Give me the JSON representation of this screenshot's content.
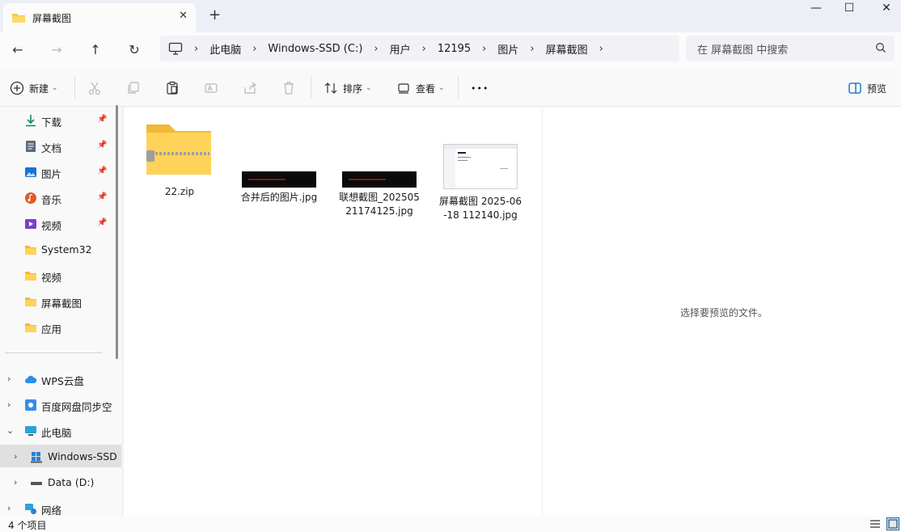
{
  "tab": {
    "title": "屏幕截图",
    "close": "✕",
    "new_tab": "+"
  },
  "window": {
    "minimize": "—",
    "maximize": "☐",
    "close": "✕"
  },
  "nav": {
    "back": "←",
    "forward": "→",
    "up": "↑",
    "refresh": "↻"
  },
  "breadcrumbs": [
    "此电脑",
    "Windows-SSD (C:)",
    "用户",
    "12195",
    "图片",
    "屏幕截图"
  ],
  "search": {
    "placeholder": "在 屏幕截图 中搜索"
  },
  "toolbar": {
    "new_label": "新建",
    "sort_label": "排序",
    "view_label": "查看",
    "more_label": "•••",
    "preview_label": "预览"
  },
  "sidebar": {
    "quick_access": [
      {
        "label": "下载",
        "icon": "download-icon",
        "pinned": true
      },
      {
        "label": "文档",
        "icon": "document-icon",
        "pinned": true
      },
      {
        "label": "图片",
        "icon": "pictures-icon",
        "pinned": true
      },
      {
        "label": "音乐",
        "icon": "music-icon",
        "pinned": true
      },
      {
        "label": "视频",
        "icon": "video-icon",
        "pinned": true
      },
      {
        "label": "System32",
        "icon": "folder-icon",
        "pinned": false
      },
      {
        "label": "视频",
        "icon": "folder-icon",
        "pinned": false
      },
      {
        "label": "屏幕截图",
        "icon": "folder-icon",
        "pinned": false
      },
      {
        "label": "应用",
        "icon": "folder-icon",
        "pinned": false
      }
    ],
    "tree": [
      {
        "label": "WPS云盘",
        "icon": "cloud-icon"
      },
      {
        "label": "百度网盘同步空",
        "icon": "baidu-netdisk-icon"
      },
      {
        "label": "此电脑",
        "icon": "pc-icon"
      },
      {
        "label": "Windows-SSD",
        "icon": "windows-drive-icon"
      },
      {
        "label": "Data (D:)",
        "icon": "drive-icon"
      },
      {
        "label": "网络",
        "icon": "network-icon"
      }
    ]
  },
  "files": [
    {
      "name": "22.zip",
      "type": "zip-folder"
    },
    {
      "name": "合并后的图片.jpg",
      "type": "image"
    },
    {
      "name": "联想截图_20250521174125.jpg",
      "type": "image"
    },
    {
      "name": "屏幕截图 2025-06-18 112140.jpg",
      "type": "image"
    }
  ],
  "preview": {
    "message": "选择要预览的文件。"
  },
  "status": {
    "item_count": "4 个项目"
  },
  "colors": {
    "folder": "#f8c94a",
    "accent": "#0067c0",
    "titlebar": "#ecf0f6"
  }
}
